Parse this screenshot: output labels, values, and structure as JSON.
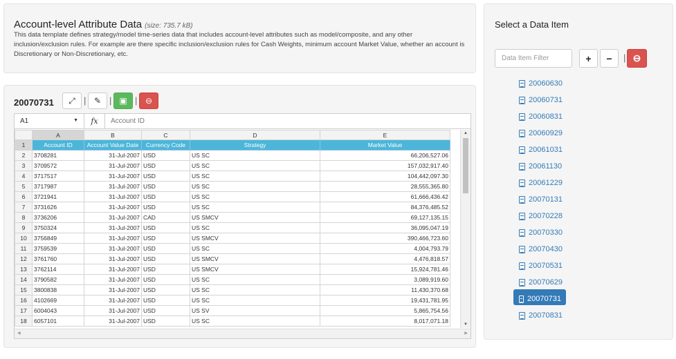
{
  "info": {
    "title": "Account-level Attribute Data",
    "size": "(size: 735.7 kB)",
    "description": "This data template defines strategy/model time-series data that includes account-level attributes such as model/composite, and any other inclusion/exclusion rules. For example are there specific inclusion/exclusion rules for Cash Weights, minimum account Market Value, whether an account is Discretionary or Non-Discretionary, etc."
  },
  "editor": {
    "title": "20070731",
    "cell_ref": "A1",
    "fx": "fx",
    "formula": "Account ID",
    "col_letters": [
      "A",
      "B",
      "C",
      "D",
      "E"
    ],
    "header_row_num": "1",
    "headers": [
      "Account ID",
      "Account Value Date",
      "Currency Code",
      "Strategy",
      "Market Value"
    ],
    "rows": [
      [
        "2",
        "3708281",
        "31-Jul-2007",
        "USD",
        "US SC",
        "66,206,527.06"
      ],
      [
        "3",
        "3709572",
        "31-Jul-2007",
        "USD",
        "US SC",
        "157,032,917.40"
      ],
      [
        "4",
        "3717517",
        "31-Jul-2007",
        "USD",
        "US SC",
        "104,442,097.30"
      ],
      [
        "5",
        "3717987",
        "31-Jul-2007",
        "USD",
        "US SC",
        "28,555,365.80"
      ],
      [
        "6",
        "3721941",
        "31-Jul-2007",
        "USD",
        "US SC",
        "61,666,436.42"
      ],
      [
        "7",
        "3731626",
        "31-Jul-2007",
        "USD",
        "US SC",
        "84,376,485.52"
      ],
      [
        "8",
        "3736206",
        "31-Jul-2007",
        "CAD",
        "US SMCV",
        "69,127,135.15"
      ],
      [
        "9",
        "3750324",
        "31-Jul-2007",
        "USD",
        "US SC",
        "36,095,047.19"
      ],
      [
        "10",
        "3756849",
        "31-Jul-2007",
        "USD",
        "US SMCV",
        "390,466,723.60"
      ],
      [
        "11",
        "3759539",
        "31-Jul-2007",
        "USD",
        "US SC",
        "4,004,793.79"
      ],
      [
        "12",
        "3761760",
        "31-Jul-2007",
        "USD",
        "US SMCV",
        "4,476,818.57"
      ],
      [
        "13",
        "3762114",
        "31-Jul-2007",
        "USD",
        "US SMCV",
        "15,924,781.46"
      ],
      [
        "14",
        "3790582",
        "31-Jul-2007",
        "USD",
        "US SC",
        "3,089,919.60"
      ],
      [
        "15",
        "3800838",
        "31-Jul-2007",
        "USD",
        "US SC",
        "11,430,370.68"
      ],
      [
        "16",
        "4102669",
        "31-Jul-2007",
        "USD",
        "US SC",
        "19,431,781.95"
      ],
      [
        "17",
        "6004043",
        "31-Jul-2007",
        "USD",
        "US SV",
        "5,865,754.56"
      ],
      [
        "18",
        "6057101",
        "31-Jul-2007",
        "USD",
        "US SC",
        "8,017,071.18"
      ]
    ]
  },
  "right": {
    "title": "Select a Data Item",
    "filter_placeholder": "Data Item Filter",
    "add": "+",
    "remove": "−",
    "sep": "|",
    "items": [
      "20060630",
      "20060731",
      "20060831",
      "20060929",
      "20061031",
      "20061130",
      "20061229",
      "20070131",
      "20070228",
      "20070330",
      "20070430",
      "20070531",
      "20070629",
      "20070731",
      "20070831"
    ],
    "active_item": "20070731"
  },
  "colors": {
    "accent": "#337ab7",
    "header_cyan": "#4bb6d9",
    "green": "#5cb85c",
    "red": "#d9534f"
  }
}
